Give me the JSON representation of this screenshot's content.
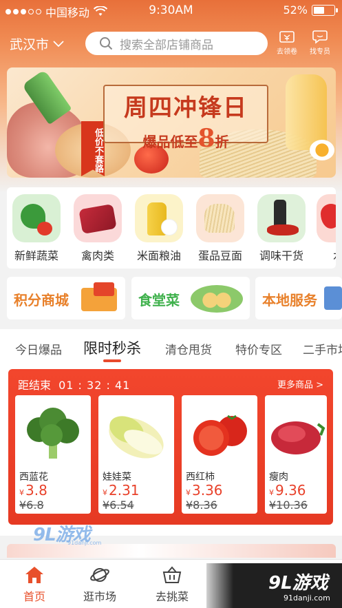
{
  "status_bar": {
    "carrier": "中国移动",
    "time": "9:30AM",
    "battery": "52%"
  },
  "header": {
    "city": "武汉市",
    "search_placeholder": "搜索全部店铺商品",
    "coupon_label": "去领卷",
    "agent_label": "找专员"
  },
  "banner": {
    "title": "周四冲锋日",
    "subtitle_prefix": "爆品低至",
    "discount_number": "8",
    "discount_unit": "折",
    "ribbon": "低价不套路"
  },
  "categories": [
    {
      "label": "新鲜蔬菜"
    },
    {
      "label": "禽肉类"
    },
    {
      "label": "米面粮油"
    },
    {
      "label": "蛋品豆面"
    },
    {
      "label": "调味干货"
    },
    {
      "label": "水"
    }
  ],
  "promos": [
    {
      "label": "积分商城",
      "color": "#e8802a"
    },
    {
      "label": "食堂菜",
      "color": "#3fb14c"
    },
    {
      "label": "本地服务",
      "color": "#e8802a"
    }
  ],
  "tabs": [
    {
      "label": "今日爆品"
    },
    {
      "label": "限时秒杀",
      "active": true
    },
    {
      "label": "清仓甩货"
    },
    {
      "label": "特价专区"
    },
    {
      "label": "二手市场"
    }
  ],
  "flash_sale": {
    "countdown_label": "距结束",
    "countdown": "01 : 32 : 41",
    "more_label": "更多商品 >",
    "products": [
      {
        "name": "西蓝花",
        "currency": "¥",
        "price": "3.8",
        "original": "¥6.8"
      },
      {
        "name": "娃娃菜",
        "currency": "¥",
        "price": "2.31",
        "original": "¥6.54"
      },
      {
        "name": "西红柿",
        "currency": "¥",
        "price": "3.36",
        "original": "¥8.36"
      },
      {
        "name": "瘦肉",
        "currency": "¥",
        "price": "9.36",
        "original": "¥10.36"
      }
    ]
  },
  "bottom_nav": [
    {
      "label": "首页",
      "icon": "home-icon",
      "active": true
    },
    {
      "label": "逛市场",
      "icon": "planet-icon"
    },
    {
      "label": "去挑菜",
      "icon": "basket-icon"
    }
  ],
  "watermarks": {
    "left_big": "9L游戏",
    "left_small": "91danji.com",
    "right_big": "9L游戏",
    "right_small": "91danji.com"
  },
  "colors": {
    "accent": "#e8502b",
    "flash_bg": "#f2462d",
    "price": "#e8412a"
  }
}
